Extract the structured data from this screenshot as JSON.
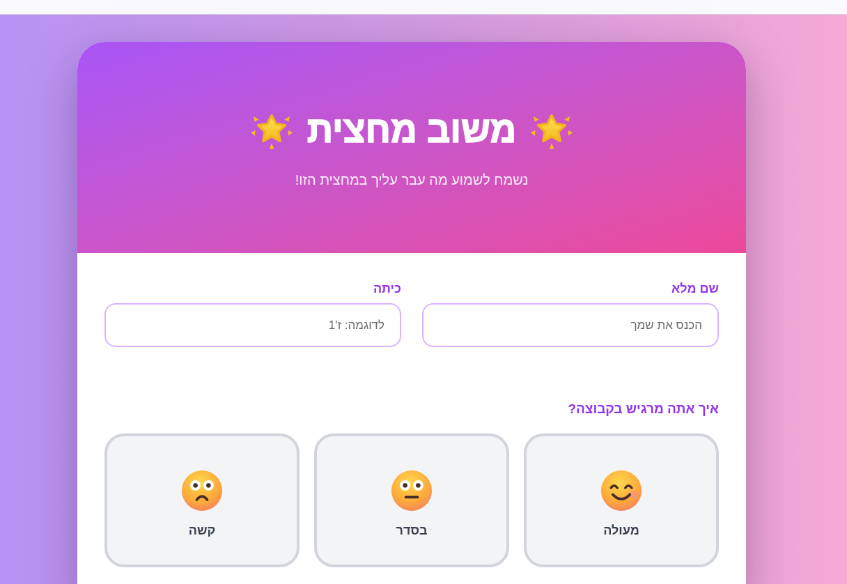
{
  "header": {
    "title": "משוב מחצית",
    "subtitle": "נשמח לשמוע מה עבר עליך במחצית הזו!"
  },
  "fields": [
    {
      "label": "שם מלא",
      "placeholder": "הכנס את שמך"
    },
    {
      "label": "כיתה",
      "placeholder": "לדוגמה: ז'1"
    }
  ],
  "mood_question": {
    "label": "איך אתה מרגיש בקבוצה?",
    "options": [
      {
        "label": "מעולה",
        "kind": "smile",
        "selected": false
      },
      {
        "label": "בסדר",
        "kind": "neutral",
        "selected": false
      },
      {
        "label": "קשה",
        "kind": "frown",
        "selected": false
      }
    ]
  }
}
